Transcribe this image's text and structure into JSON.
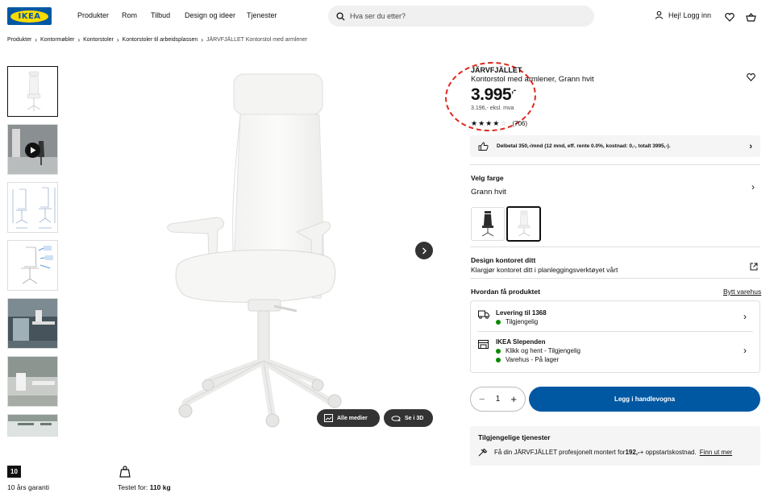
{
  "header": {
    "logo_text": "IKEA",
    "nav": [
      "Produkter",
      "Rom",
      "Tilbud",
      "Design og ideer",
      "Tjenester"
    ],
    "search_placeholder": "Hva ser du etter?",
    "login_label": "Hej! Logg inn"
  },
  "breadcrumb": [
    "Produkter",
    "Kontormøbler",
    "Kontorstoler",
    "Kontorstoler til arbeidsplassen",
    "JÄRVFJÄLLET Kontorstol med armlener"
  ],
  "gallery": {
    "buttons": {
      "all_media": "Alle medier",
      "view_3d": "Se i 3D"
    }
  },
  "product": {
    "name": "JÄRVFJÄLLET",
    "description": "Kontorstol med armlener, Grann hvit",
    "price": "3.995",
    "price_suffix": ",-",
    "price_ex_vat": "3.196,- eksl. mva",
    "rating_stars": 4,
    "review_count": "(706)",
    "finance_text": "Delbetal 350,-/mnd (12 mnd, eff. rente 0.0%, kostnad: 0,-, totalt 3995,-)."
  },
  "color": {
    "title": "Velg farge",
    "selected": "Grann hvit"
  },
  "design": {
    "title": "Design kontoret ditt",
    "text": "Klargjør kontoret ditt i planleggingsverktøyet vårt"
  },
  "availability": {
    "title": "Hvordan få produktet",
    "change_store": "Bytt varehus",
    "delivery_title": "Levering til 1368",
    "delivery_status": "Tilgjengelig",
    "store_title": "IKEA Slependen",
    "store_click_collect": "Klikk og hent - Tilgjengelig",
    "store_stock": "Varehus - På lager"
  },
  "purchase": {
    "quantity": "1",
    "add_to_cart": "Legg i handlevogna"
  },
  "services": {
    "title": "Tilgjengelige tjenester",
    "text_prefix": "Få din JÄRVFJÄLLET profesjonelt montert for ",
    "price": "192,-",
    "text_suffix": " + oppstartskostnad.",
    "link": "Finn ut mer"
  },
  "footer": {
    "warranty_badge": "10",
    "warranty_text": "10 års garanti",
    "tested_prefix": "Testet for: ",
    "tested_value": "110 kg"
  },
  "colors": {
    "ikea_blue": "#0058a3",
    "ikea_yellow": "#ffdb00",
    "available_green": "#0a8a00",
    "annotation_red": "#e1251b"
  }
}
